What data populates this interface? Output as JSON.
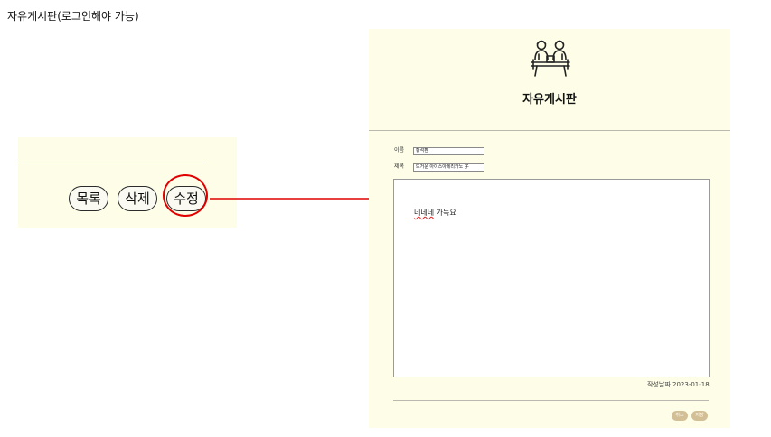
{
  "caption": "자유게시판(로그인해야 가능)",
  "left": {
    "buttons": {
      "list": "목록",
      "delete": "삭제",
      "edit": "수정"
    }
  },
  "board": {
    "title": "자유게시판",
    "icon": "people-at-table-icon",
    "form": {
      "name_label": "이름",
      "name_value": "황석환",
      "subject_label": "제목",
      "subject_value": "뜨거운 아이스아메리카노 子"
    },
    "content_spell": "네네네",
    "content_rest": " 가득요",
    "date_label": "작성날짜",
    "date_value": "2023-01-18",
    "buttons": {
      "cancel": "취소",
      "save": "저장"
    }
  },
  "colors": {
    "panel_bg": "#fdfde8",
    "highlight": "#e00000",
    "button_tan": "#d3bf96"
  }
}
